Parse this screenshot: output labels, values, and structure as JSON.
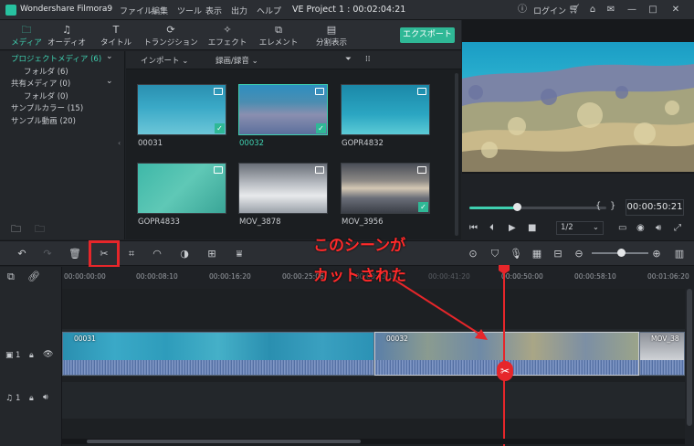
{
  "titlebar": {
    "app_name": "Wondershare Filmora9",
    "menus": [
      "ファイル",
      "編集",
      "ツール",
      "表示",
      "出力",
      "ヘルプ"
    ],
    "project": "VE Project 1 : 00:02:04:21",
    "login": "ログイン"
  },
  "tabs": [
    {
      "label": "メディア",
      "icon": "folder-icon"
    },
    {
      "label": "オーディオ",
      "icon": "music-note-icon"
    },
    {
      "label": "タイトル",
      "icon": "title-text-icon"
    },
    {
      "label": "トランジション",
      "icon": "transition-icon"
    },
    {
      "label": "エフェクト",
      "icon": "effects-icon"
    },
    {
      "label": "エレメント",
      "icon": "elements-icon"
    },
    {
      "label": "分割表示",
      "icon": "split-screen-icon"
    }
  ],
  "export_label": "エクスポート",
  "tree": {
    "items": [
      {
        "label": "プロジェクトメディア (6)",
        "level": 0
      },
      {
        "label": "フォルダ (6)",
        "level": 1
      },
      {
        "label": "共有メディア (0)",
        "level": 0
      },
      {
        "label": "フォルダ (0)",
        "level": 1
      },
      {
        "label": "サンプルカラー (15)",
        "level": 0
      },
      {
        "label": "サンプル動画 (20)",
        "level": 0
      }
    ]
  },
  "media": {
    "import_label": "インポート",
    "record_label": "録画/録音",
    "search_placeholder": "検索",
    "items": [
      {
        "name": "00031",
        "selected": false,
        "checked": true
      },
      {
        "name": "00032",
        "selected": true,
        "checked": true
      },
      {
        "name": "GOPR4832",
        "selected": false,
        "checked": false
      },
      {
        "name": "GOPR4833",
        "selected": false,
        "checked": false
      },
      {
        "name": "MOV_3878",
        "selected": false,
        "checked": false
      },
      {
        "name": "MOV_3956",
        "selected": false,
        "checked": true
      }
    ]
  },
  "preview": {
    "timecode": "00:00:50:21",
    "ratio": "1/2",
    "progress": 0.35
  },
  "timeline": {
    "ticks": [
      "00:00:00:00",
      "00:00:08:10",
      "00:00:16:20",
      "00:00:25:06",
      "00:00:33:16",
      "00:00:41:20",
      "00:00:50:00",
      "00:00:58:10",
      "00:01:06:20"
    ],
    "video_track_label": "1",
    "audio_track_label": "1",
    "clips": [
      "00031",
      "00032",
      "MOV_38"
    ]
  },
  "annotation": {
    "line1": "このシーンが",
    "line2": "カットされた"
  },
  "colors": {
    "accent": "#2fb896",
    "highlight": "#e6262a"
  }
}
